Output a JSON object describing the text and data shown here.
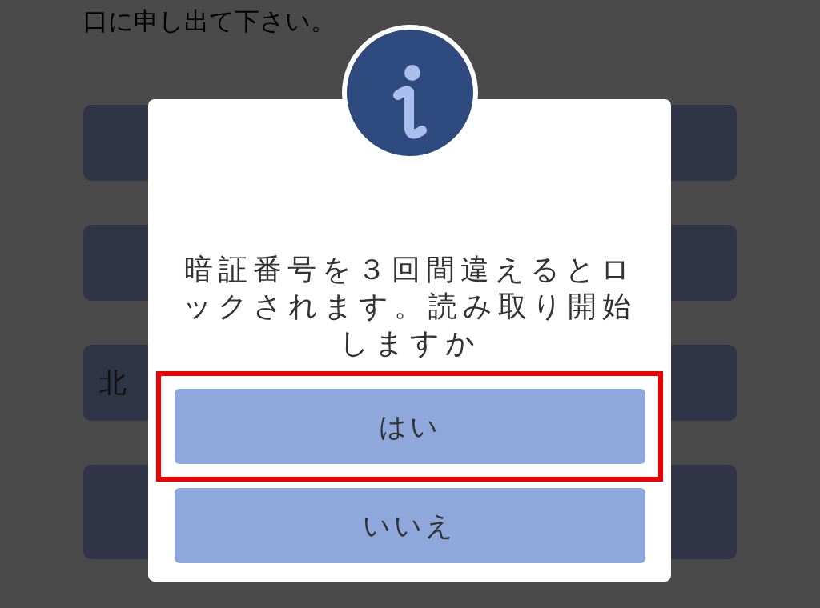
{
  "background": {
    "notice": "口に申し出て下さい。",
    "buttons": [
      {
        "kind": "button"
      },
      {
        "kind": "button"
      },
      {
        "kind": "button",
        "label": "北"
      },
      {
        "kind": "button"
      }
    ]
  },
  "dialog": {
    "message": "暗証番号を３回間違えるとロックされます。読み取り開始しますか",
    "buttons": [
      {
        "label": "はい",
        "highlighted": true
      },
      {
        "label": "いいえ",
        "highlighted": false
      }
    ]
  }
}
